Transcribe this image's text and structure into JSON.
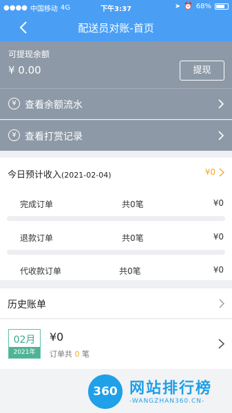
{
  "status_bar": {
    "carrier": "中国移动",
    "network": "4G",
    "time": "下午3:37",
    "battery": "68%"
  },
  "nav": {
    "title": "配送员对账-首页"
  },
  "balance": {
    "label": "可提现余额",
    "amount": "¥ 0.00",
    "withdraw_label": "提现"
  },
  "menu": [
    {
      "label": "查看余额流水",
      "icon": "yen-circle-icon"
    },
    {
      "label": "查看打赏记录",
      "icon": "yen-circle-icon"
    }
  ],
  "income": {
    "title": "今日预计收入",
    "date": "(2021-02-04)",
    "total": "¥0",
    "rows": [
      {
        "name": "完成订单",
        "count": "共0笔",
        "amount": "¥0"
      },
      {
        "name": "退款订单",
        "count": "共0笔",
        "amount": "¥0"
      },
      {
        "name": "代收款订单",
        "count": "共0笔",
        "amount": "¥0"
      }
    ]
  },
  "history": {
    "title": "历史账单"
  },
  "bill": {
    "month": "02月",
    "year": "2021年",
    "amount": "¥0",
    "sub_prefix": "订单共",
    "sub_count": "0",
    "sub_suffix": "笔"
  },
  "watermark": {
    "badge": "360",
    "title": "网站排行榜",
    "subtitle": "-WANGZHAN360.CN-"
  },
  "colors": {
    "primary": "#4a9ff5",
    "card": "#8d99a6",
    "accent": "#f5a623",
    "month_green": "#4fb496"
  }
}
